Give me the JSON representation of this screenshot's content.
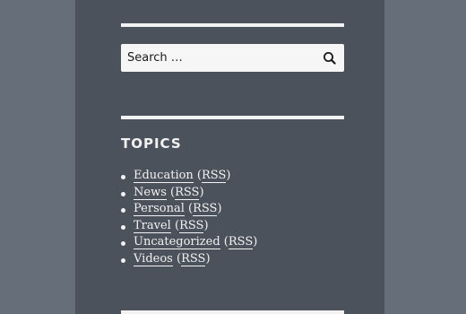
{
  "search": {
    "placeholder": "Search …",
    "button_icon": "search-icon"
  },
  "topics": {
    "title": "TOPICS",
    "items": [
      {
        "label": "Education",
        "feed": "RSS"
      },
      {
        "label": "News",
        "feed": "RSS"
      },
      {
        "label": "Personal",
        "feed": "RSS"
      },
      {
        "label": "Travel",
        "feed": "RSS"
      },
      {
        "label": "Uncategorized",
        "feed": "RSS"
      },
      {
        "label": "Videos",
        "feed": "RSS"
      }
    ]
  },
  "colors": {
    "page_bg": "#656e79",
    "panel_bg": "#4b525b",
    "text": "#f2f2f2",
    "search_bg": "#f6f6f6"
  }
}
